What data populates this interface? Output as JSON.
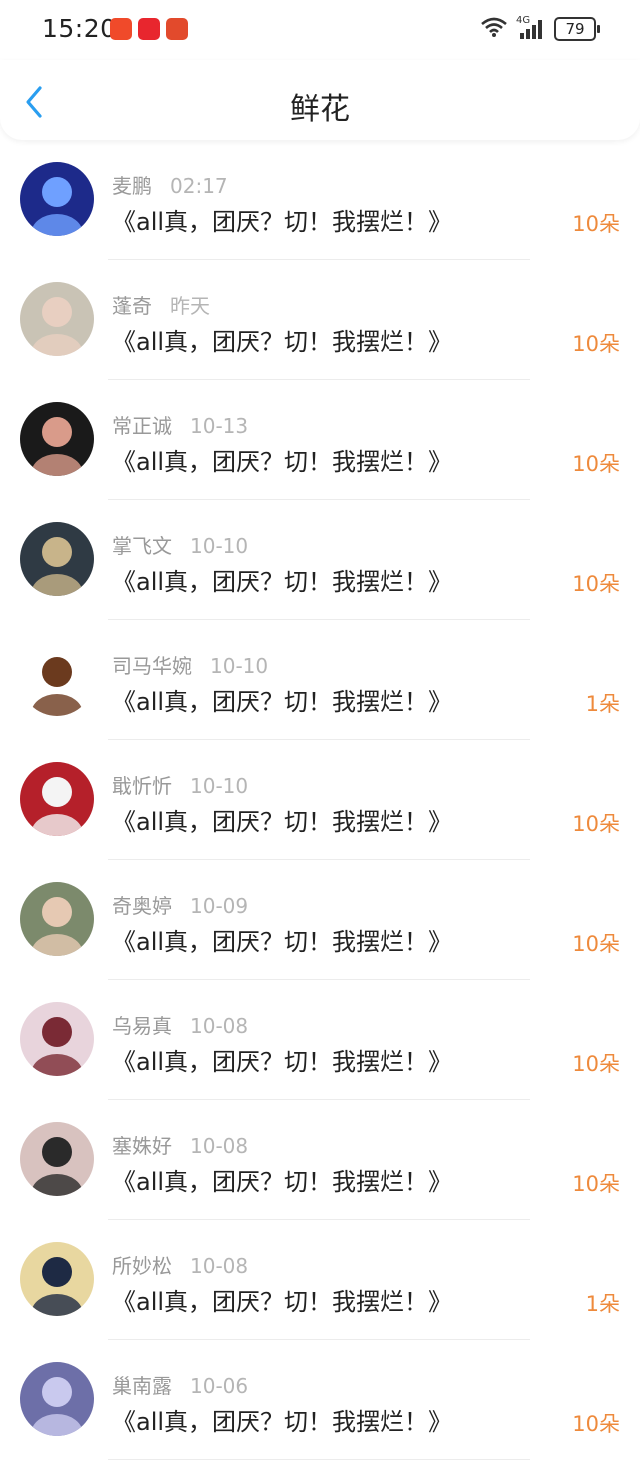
{
  "status_bar": {
    "time": "15:20",
    "network": "4G",
    "battery": "79",
    "app_icons": [
      {
        "icon": "taobao-app-icon",
        "color": "#f04a2a"
      },
      {
        "icon": "shopping-app-icon",
        "color": "#e8262e"
      },
      {
        "icon": "news-app-icon",
        "color": "#e24a2c"
      }
    ]
  },
  "header": {
    "title": "鲜花",
    "back_icon": "chevron-left-icon"
  },
  "colors": {
    "accent": "#2a9ef0",
    "count": "#ee8a3c",
    "name": "#999999",
    "time": "#b5b5b5"
  },
  "gifts": [
    {
      "name": "麦鹏",
      "time": "02:17",
      "message": "《all真，团厌？切！我摆烂！》",
      "count": "10朵"
    },
    {
      "name": "蓬奇",
      "time": "昨天",
      "message": "《all真，团厌？切！我摆烂！》",
      "count": "10朵"
    },
    {
      "name": "常正诚",
      "time": "10-13",
      "message": "《all真，团厌？切！我摆烂！》",
      "count": "10朵"
    },
    {
      "name": "掌飞文",
      "time": "10-10",
      "message": "《all真，团厌？切！我摆烂！》",
      "count": "10朵"
    },
    {
      "name": "司马华婉",
      "time": "10-10",
      "message": "《all真，团厌？切！我摆烂！》",
      "count": "1朵"
    },
    {
      "name": "戢忻忻",
      "time": "10-10",
      "message": "《all真，团厌？切！我摆烂！》",
      "count": "10朵"
    },
    {
      "name": "奇奥婷",
      "time": "10-09",
      "message": "《all真，团厌？切！我摆烂！》",
      "count": "10朵"
    },
    {
      "name": "乌易真",
      "time": "10-08",
      "message": "《all真，团厌？切！我摆烂！》",
      "count": "10朵"
    },
    {
      "name": "塞姝好",
      "time": "10-08",
      "message": "《all真，团厌？切！我摆烂！》",
      "count": "10朵"
    },
    {
      "name": "所妙松",
      "time": "10-08",
      "message": "《all真，团厌？切！我摆烂！》",
      "count": "1朵"
    },
    {
      "name": "巢南露",
      "time": "10-06",
      "message": "《all真，团厌？切！我摆烂！》",
      "count": "10朵"
    }
  ],
  "avatars": [
    {
      "bg": "#1d2a8a",
      "fg": "#6fa0ff"
    },
    {
      "bg": "#c9c3b5",
      "fg": "#e8cfc1"
    },
    {
      "bg": "#1a1a1a",
      "fg": "#d99b8a"
    },
    {
      "bg": "#2f3a44",
      "fg": "#c8b48a"
    },
    {
      "bg": "#ffffff",
      "fg": "#6b3a1e"
    },
    {
      "bg": "#b5202a",
      "fg": "#f4f4f4"
    },
    {
      "bg": "#7c8a6c",
      "fg": "#e6c9b3"
    },
    {
      "bg": "#e8d4dc",
      "fg": "#7a2a35"
    },
    {
      "bg": "#d8c2bf",
      "fg": "#2a2a2a"
    },
    {
      "bg": "#e8d7a0",
      "fg": "#1e2a44"
    },
    {
      "bg": "#6d6fa8",
      "fg": "#c9c9ee"
    }
  ]
}
